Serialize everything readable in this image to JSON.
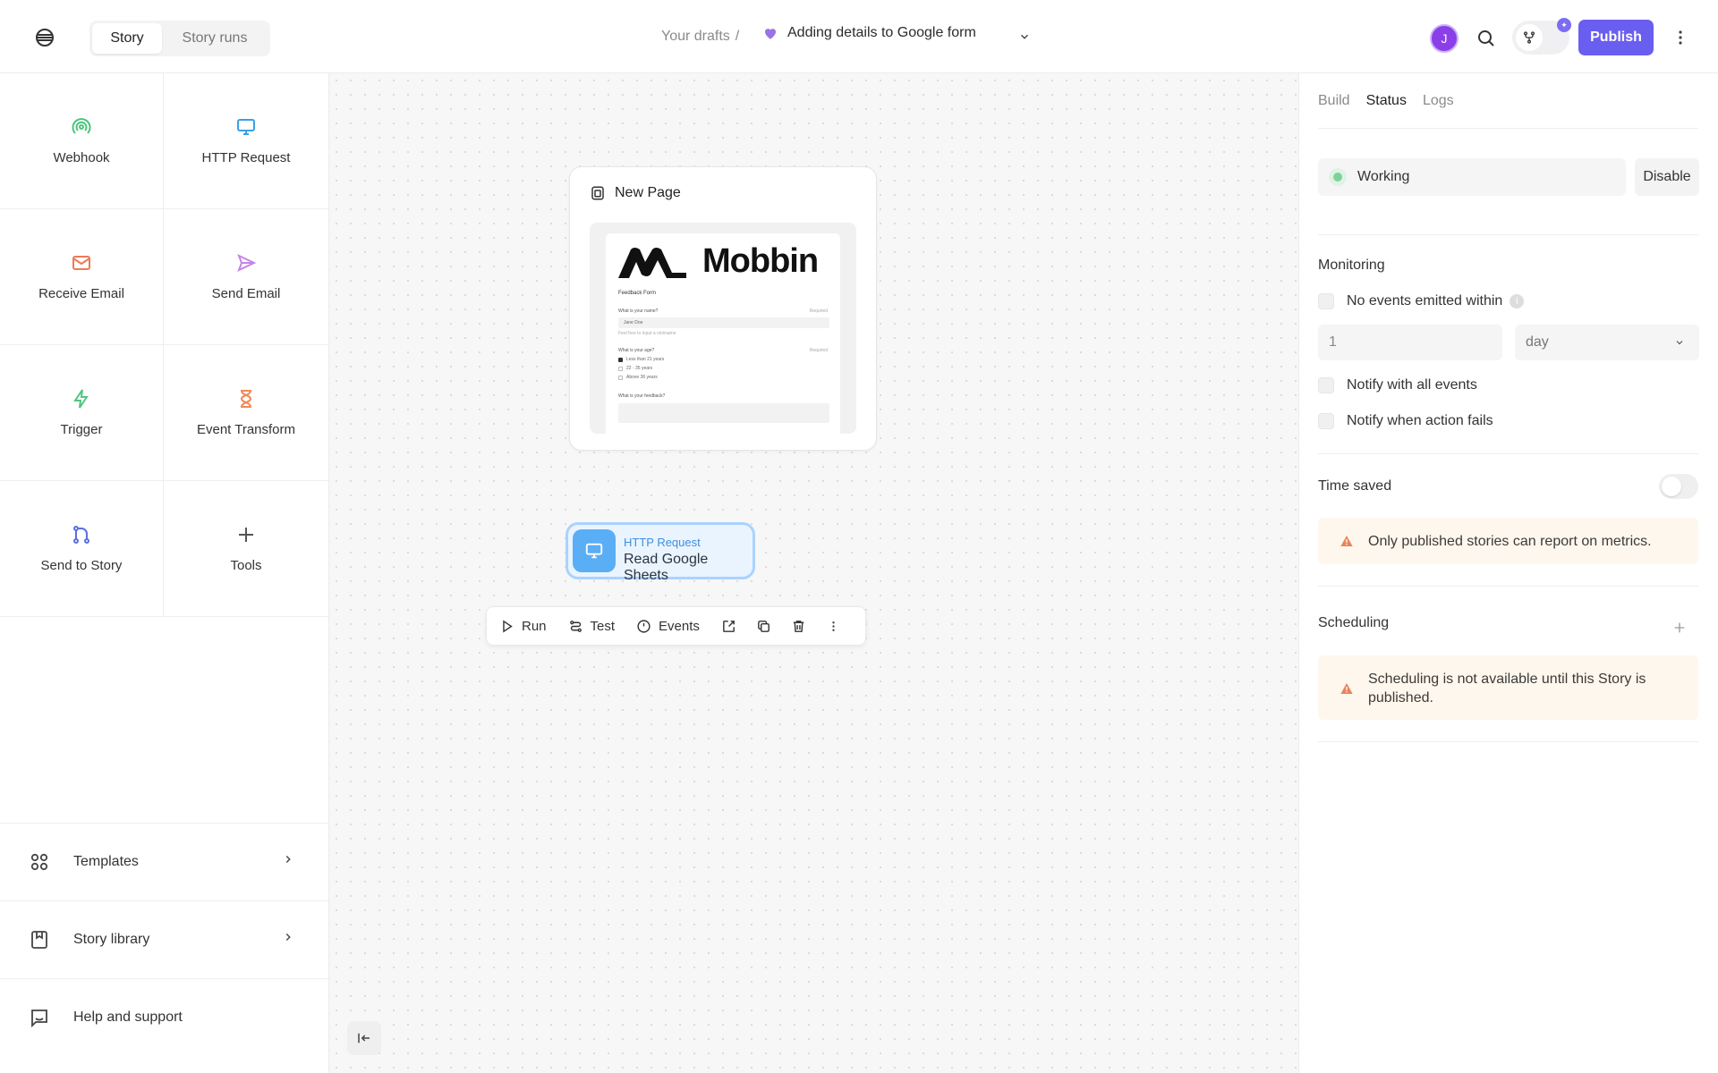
{
  "header": {
    "tabs": [
      {
        "label": "Story",
        "active": true
      },
      {
        "label": "Story runs",
        "active": false
      }
    ],
    "breadcrumb_root": "Your drafts",
    "breadcrumb_sep": "/",
    "story_title": "Adding details to Google form",
    "avatar_initial": "J",
    "publish_label": "Publish"
  },
  "sidebar": {
    "tiles": [
      {
        "label": "Webhook",
        "icon": "webhook-icon",
        "color": "#4cc37b"
      },
      {
        "label": "HTTP Request",
        "icon": "monitor-icon",
        "color": "#3aa0e6"
      },
      {
        "label": "Receive Email",
        "icon": "mail-icon",
        "color": "#ee7a57"
      },
      {
        "label": "Send Email",
        "icon": "send-icon",
        "color": "#c585e6"
      },
      {
        "label": "Trigger",
        "icon": "bolt-icon",
        "color": "#52c483"
      },
      {
        "label": "Event Transform",
        "icon": "hourglass-icon",
        "color": "#ee8a57"
      },
      {
        "label": "Send to Story",
        "icon": "git-merge-icon",
        "color": "#5a6fe0"
      },
      {
        "label": "Tools",
        "icon": "plus-icon",
        "color": "#555555"
      }
    ],
    "bottom": [
      {
        "label": "Templates",
        "icon": "grid-circles-icon"
      },
      {
        "label": "Story library",
        "icon": "bookmark-icon"
      },
      {
        "label": "Help and support",
        "icon": "chat-icon"
      }
    ]
  },
  "canvas": {
    "page_node": {
      "title": "New Page",
      "preview": {
        "brand": "Mobbin",
        "form_title": "Feedback Form",
        "q1": "What is your name?",
        "q1_required": "Required",
        "q1_value": "Jane Doe",
        "q1_hint": "Feel free to input a nickname",
        "q2": "What is your age?",
        "q2_required": "Required",
        "q2_options": [
          "Less than 21 years",
          "22 - 35 years",
          "Above 36 years"
        ],
        "q3": "What is your feedback?"
      }
    },
    "http_node": {
      "kind": "HTTP Request",
      "name": "Read Google Sheets"
    },
    "toolbar": {
      "run": "Run",
      "test": "Test",
      "events": "Events"
    }
  },
  "panel": {
    "tabs": [
      {
        "label": "Build",
        "active": false
      },
      {
        "label": "Status",
        "active": true
      },
      {
        "label": "Logs",
        "active": false
      }
    ],
    "status_label": "Working",
    "disable_label": "Disable",
    "monitoring": {
      "title": "Monitoring",
      "no_events_label": "No events emitted within",
      "amount": "1",
      "unit": "day",
      "notify_all": "Notify with all events",
      "notify_fail": "Notify when action fails"
    },
    "time_saved": {
      "title": "Time saved",
      "warning": "Only published stories can report on metrics."
    },
    "scheduling": {
      "title": "Scheduling",
      "warning": "Scheduling is not available until this Story is published."
    }
  },
  "colors": {
    "accent": "#6a5ef0",
    "warning_bg": "#fdf7ee",
    "warning_icon": "#e8845a",
    "node_blue": "#5aaef5"
  }
}
